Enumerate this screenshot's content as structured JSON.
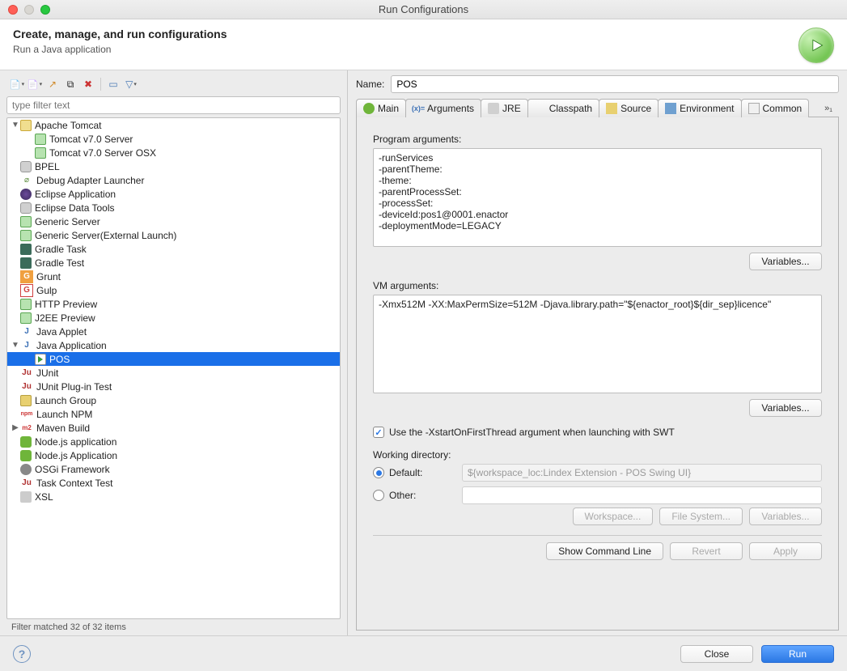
{
  "window": {
    "title": "Run Configurations"
  },
  "header": {
    "title": "Create, manage, and run configurations",
    "subtitle": "Run a Java application"
  },
  "filter": {
    "placeholder": "type filter text",
    "status": "Filter matched 32 of 32 items"
  },
  "tree": [
    {
      "label": "Apache Tomcat",
      "level": 0,
      "expanded": true,
      "icon": "cat"
    },
    {
      "label": "Tomcat v7.0 Server",
      "level": 1,
      "icon": "srv"
    },
    {
      "label": "Tomcat v7.0 Server OSX",
      "level": 1,
      "icon": "srv"
    },
    {
      "label": "BPEL",
      "level": 0,
      "icon": "db"
    },
    {
      "label": "Debug Adapter Launcher",
      "level": 0,
      "icon": "bug"
    },
    {
      "label": "Eclipse Application",
      "level": 0,
      "icon": "eclipse"
    },
    {
      "label": "Eclipse Data Tools",
      "level": 0,
      "icon": "db"
    },
    {
      "label": "Generic Server",
      "level": 0,
      "icon": "srv"
    },
    {
      "label": "Generic Server(External Launch)",
      "level": 0,
      "icon": "srv"
    },
    {
      "label": "Gradle Task",
      "level": 0,
      "icon": "gradle"
    },
    {
      "label": "Gradle Test",
      "level": 0,
      "icon": "gradle"
    },
    {
      "label": "Grunt",
      "level": 0,
      "icon": "grunt"
    },
    {
      "label": "Gulp",
      "level": 0,
      "icon": "gulp"
    },
    {
      "label": "HTTP Preview",
      "level": 0,
      "icon": "srv"
    },
    {
      "label": "J2EE Preview",
      "level": 0,
      "icon": "srv"
    },
    {
      "label": "Java Applet",
      "level": 0,
      "icon": "java"
    },
    {
      "label": "Java Application",
      "level": 0,
      "expanded": true,
      "icon": "java"
    },
    {
      "label": "POS",
      "level": 1,
      "icon": "run",
      "selected": true
    },
    {
      "label": "JUnit",
      "level": 0,
      "icon": "junit"
    },
    {
      "label": "JUnit Plug-in Test",
      "level": 0,
      "icon": "junit"
    },
    {
      "label": "Launch Group",
      "level": 0,
      "icon": "launch"
    },
    {
      "label": "Launch NPM",
      "level": 0,
      "icon": "npm"
    },
    {
      "label": "Maven Build",
      "level": 0,
      "expandable": true,
      "icon": "maven"
    },
    {
      "label": "Node.js application",
      "level": 0,
      "icon": "node"
    },
    {
      "label": "Node.js Application",
      "level": 0,
      "icon": "node"
    },
    {
      "label": "OSGi Framework",
      "level": 0,
      "icon": "osgi"
    },
    {
      "label": "Task Context Test",
      "level": 0,
      "icon": "junit"
    },
    {
      "label": "XSL",
      "level": 0,
      "icon": "xsl"
    }
  ],
  "form": {
    "nameLabel": "Name:",
    "nameValue": "POS",
    "tabs": [
      {
        "label": "Main",
        "icon": "main"
      },
      {
        "label": "Arguments",
        "icon": "args",
        "active": true
      },
      {
        "label": "JRE",
        "icon": "jre"
      },
      {
        "label": "Classpath",
        "icon": "cp"
      },
      {
        "label": "Source",
        "icon": "src"
      },
      {
        "label": "Environment",
        "icon": "env"
      },
      {
        "label": "Common",
        "icon": "common"
      }
    ],
    "overflow": "»₁",
    "programArgsLabel": "Program arguments:",
    "programArgs": "-runServices\n-parentTheme:\n-theme:\n-parentProcessSet:\n-processSet:\n-deviceId:pos1@0001.enactor\n-deploymentMode=LEGACY",
    "vmArgsLabel": "VM arguments:",
    "vmArgs": "-Xmx512M -XX:MaxPermSize=512M -Djava.library.path=\"${enactor_root}${dir_sep}licence\"",
    "variablesBtn": "Variables...",
    "swtCheck": "Use the -XstartOnFirstThread argument when launching with SWT",
    "swtChecked": true,
    "workingDirLabel": "Working directory:",
    "defaultLabel": "Default:",
    "defaultValue": "${workspace_loc:Lindex Extension - POS Swing UI}",
    "otherLabel": "Other:",
    "workspaceBtn": "Workspace...",
    "fileSystemBtn": "File System...",
    "variablesBtn2": "Variables...",
    "showCmd": "Show Command Line",
    "revert": "Revert",
    "apply": "Apply"
  },
  "footer": {
    "close": "Close",
    "run": "Run"
  },
  "iconMap": {
    "cat": "sq sq-cat",
    "srv": "sq sq-srv",
    "eclipse": "sq sq-eclipse",
    "db": "sq sq-db",
    "gradle": "sq sq-gradle",
    "grunt": "ticon sq-grunt",
    "gulp": "ticon sq-gulp",
    "java": "ticon sq-java",
    "junit": "ticon sq-junit",
    "node": "sq sq-node",
    "maven": "ticon sq-maven",
    "launch": "sq sq-launch",
    "npm": "ticon sq-npm",
    "osgi": "sq sq-osgi",
    "xsl": "sq sq-xsl",
    "bug": "ticon sq-bug",
    "run": "sq sq-run"
  },
  "iconText": {
    "grunt": "G",
    "gulp": "G",
    "java": "J",
    "junit": "Ju",
    "maven": "m2",
    "npm": "npm",
    "bug": "⌀"
  }
}
